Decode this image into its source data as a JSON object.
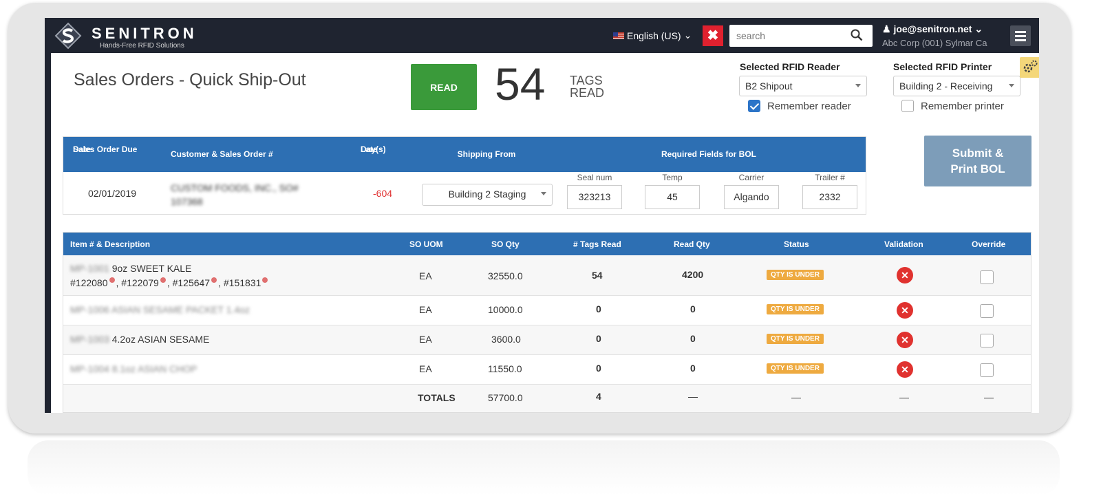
{
  "topbar": {
    "brand": "SENITRON",
    "tagline": "Hands-Free RFID Solutions",
    "language": "English (US)",
    "search_placeholder": "search",
    "user": "joe@senitron.net",
    "account": "Abc Corp (001) Sylmar Ca"
  },
  "header": {
    "title": "Sales Orders - Quick Ship-Out",
    "read_label": "READ",
    "tag_count": "54",
    "tags_label_1": "TAGS",
    "tags_label_2": "READ",
    "reader_label": "Selected RFID Reader",
    "reader_value": "B2 Shipout",
    "remember_reader": "Remember reader",
    "remember_reader_checked": true,
    "printer_label": "Selected RFID Printer",
    "printer_value": "Building 2 - Receiving",
    "remember_printer": "Remember printer",
    "remember_printer_checked": false
  },
  "order": {
    "headers": {
      "due_date_1": "Sales Order Due",
      "due_date_2": "Date",
      "customer": "Customer & Sales Order #",
      "days_1": "Day(s)",
      "days_2": "Late",
      "shipping_from": "Shipping From",
      "required": "Required Fields for BOL"
    },
    "due_date": "02/01/2019",
    "customer_line1": "CUSTOM FOODS, INC., SO#",
    "customer_line2": "107368",
    "days_late": "-604",
    "shipping_from": "Building 2 Staging",
    "fields": {
      "seal_label": "Seal num",
      "seal_value": "323213",
      "temp_label": "Temp",
      "temp_value": "45",
      "carrier_label": "Carrier",
      "carrier_value": "Algando",
      "trailer_label": "Trailer #",
      "trailer_value": "2332"
    }
  },
  "submit": {
    "line1": "Submit &",
    "line2": "Print BOL"
  },
  "items": {
    "headers": {
      "item": "Item # & Description",
      "uom": "SO UOM",
      "qty": "SO Qty",
      "tags": "# Tags Read",
      "read_qty": "Read Qty",
      "status": "Status",
      "validation": "Validation",
      "override": "Override"
    },
    "rows": [
      {
        "item_code": "MP-1001",
        "desc": "9oz SWEET KALE",
        "uom": "EA",
        "qty": "32550.0",
        "tags": "54",
        "read_qty": "4200",
        "status": "QTY IS UNDER",
        "epcs": [
          "#122080",
          "#122079",
          "#125647",
          "#151831"
        ]
      },
      {
        "item_code": "MP-1006",
        "desc": "ASIAN SESAME PACKET 1.4oz",
        "uom": "EA",
        "qty": "10000.0",
        "tags": "0",
        "read_qty": "0",
        "status": "QTY IS UNDER"
      },
      {
        "item_code": "MP-1003",
        "desc": "4.2oz ASIAN SESAME",
        "uom": "EA",
        "qty": "3600.0",
        "tags": "0",
        "read_qty": "0",
        "status": "QTY IS UNDER"
      },
      {
        "item_code": "MP-1004",
        "desc": "8.1oz ASIAN CHOP",
        "uom": "EA",
        "qty": "11550.0",
        "tags": "0",
        "read_qty": "0",
        "status": "QTY IS UNDER"
      }
    ],
    "totals": {
      "label": "TOTALS",
      "qty": "57700.0",
      "tags": "4",
      "read_qty": "—",
      "status": "—",
      "validation": "—",
      "override": "—"
    }
  },
  "colors": {
    "nav": "#1f2430",
    "header_blue": "#2d6fb3",
    "read_green": "#3a9a3a",
    "status_orange": "#eeaa40",
    "error_red": "#e0322f"
  }
}
